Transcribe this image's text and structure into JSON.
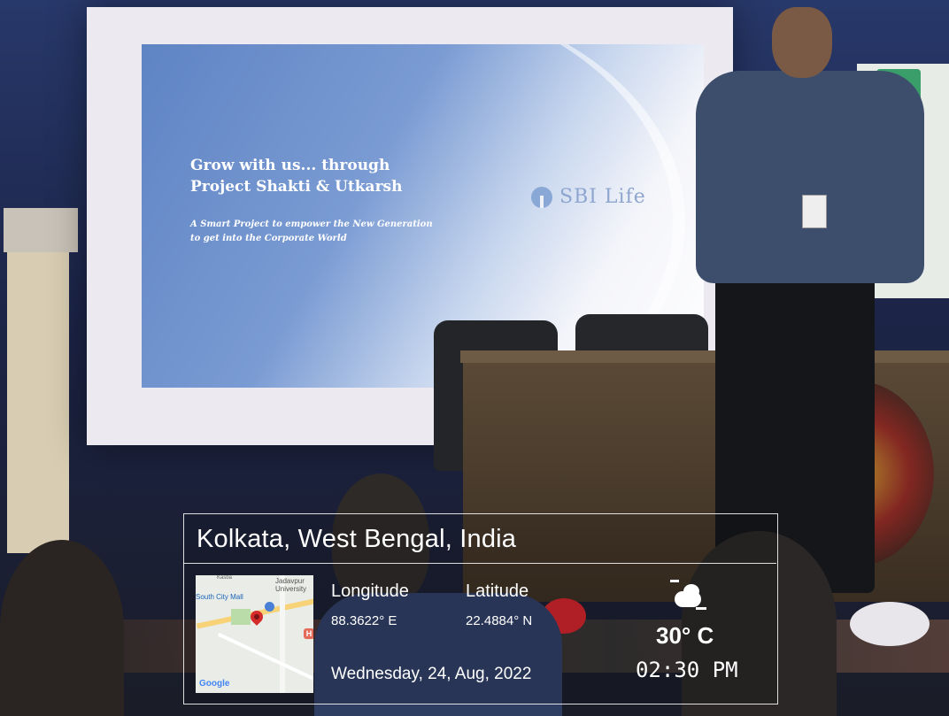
{
  "slide": {
    "title_line1": "Grow with us... through",
    "title_line2": "Project Shakti & Utkarsh",
    "subtitle_line1": "A Smart Project to empower the New Generation",
    "subtitle_line2": "to get into the Corporate World",
    "logo_text": "SBI Life"
  },
  "overlay": {
    "location": "Kolkata, West Bengal, India",
    "longitude_label": "Longitude",
    "latitude_label": "Latitude",
    "longitude_value": "88.3622° E",
    "latitude_value": "22.4884° N",
    "date": "Wednesday, 24, Aug, 2022",
    "temperature": "30° C",
    "time": "02:30 PM",
    "weather_icon": "partly-cloudy-icon"
  },
  "map": {
    "label_mall": "South City Mall",
    "label_university_1": "Jadavpur",
    "label_university_2": "University",
    "label_top": "Kasba",
    "attribution": "Google",
    "hospital_marker": "H"
  },
  "colors": {
    "slide_blue": "#6d8fcb",
    "overlay_border": "#ffffff",
    "map_pin": "#d52b2b"
  }
}
